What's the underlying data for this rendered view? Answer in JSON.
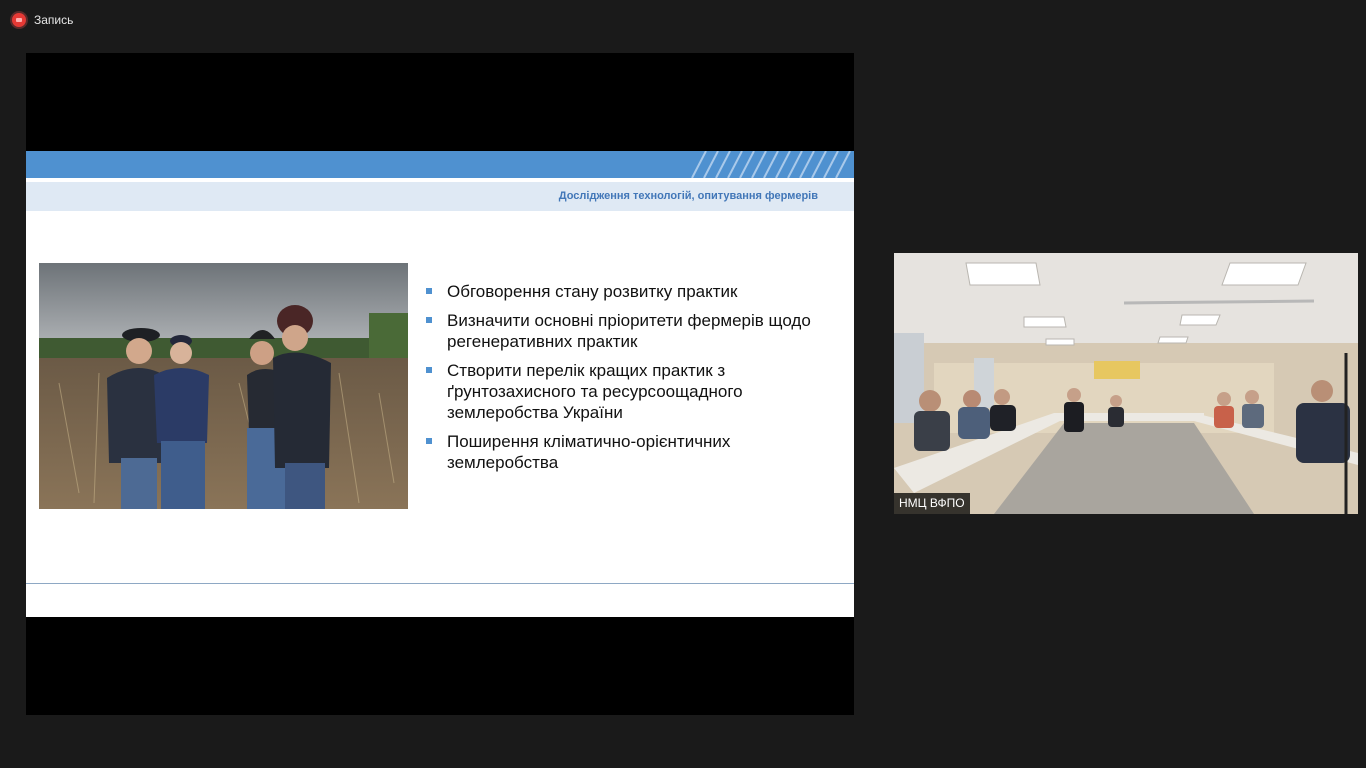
{
  "recording": {
    "label": "Запись",
    "icon": "record-icon",
    "color": "#e53935"
  },
  "shared_screen": {
    "slide": {
      "header_text": "Дослідження технологій, опитування фермерів",
      "accent_color": "#4f91d0",
      "photo": "farmers-in-field-photo",
      "bullets": [
        {
          "text": "Обговорення стану розвитку практик"
        },
        {
          "text": "Визначити основні пріоритети фермерів щодо регенеративних практик"
        },
        {
          "text": "Створити перелік кращих практик з ґрунтозахисного та ресурсоощадного землеробства України"
        },
        {
          "text": "Поширення кліматично-орієнтичних землеробства"
        }
      ]
    }
  },
  "participant_video": {
    "name": "НМЦ ВФПО",
    "scene": "conference-room-video"
  }
}
